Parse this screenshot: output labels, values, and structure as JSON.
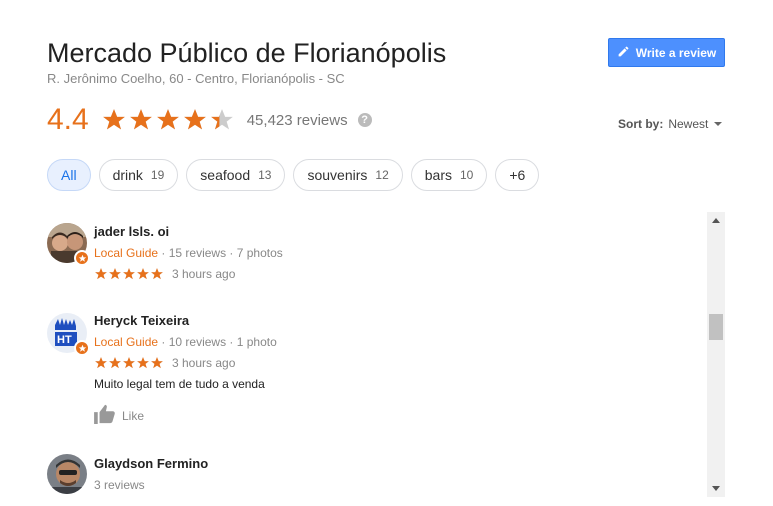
{
  "place": {
    "title": "Mercado Público de Florianópolis",
    "address": "R. Jerônimo Coelho, 60 - Centro, Florianópolis - SC"
  },
  "write_review": {
    "label": "Write a review",
    "icon": "pencil-icon"
  },
  "rating": {
    "value": "4.4",
    "stars": 4.4,
    "reviews_text": "45,423 reviews",
    "help_icon": "?"
  },
  "sort": {
    "label": "Sort by:",
    "value": "Newest"
  },
  "chips": [
    {
      "label": "All",
      "count": "",
      "active": true
    },
    {
      "label": "drink",
      "count": "19"
    },
    {
      "label": "seafood",
      "count": "13"
    },
    {
      "label": "souvenirs",
      "count": "12"
    },
    {
      "label": "bars",
      "count": "10"
    },
    {
      "label": "+6",
      "count": ""
    }
  ],
  "reviews": [
    {
      "name": "jader lsls. oi",
      "guide": "Local Guide",
      "reviews": "15 reviews",
      "photos": "7 photos",
      "stars": 5,
      "time": "3 hours ago"
    },
    {
      "name": "Heryck Teixeira",
      "guide": "Local Guide",
      "reviews": "10 reviews",
      "photos": "1 photo",
      "stars": 5,
      "time": "3 hours ago",
      "text": "Muito legal tem de tudo a venda",
      "like": "Like"
    },
    {
      "name": "Glaydson Fermino",
      "reviews": "3 reviews"
    }
  ],
  "meta_sep": " · ",
  "colors": {
    "accent": "#e7711b",
    "blue": "#4d90fe"
  }
}
